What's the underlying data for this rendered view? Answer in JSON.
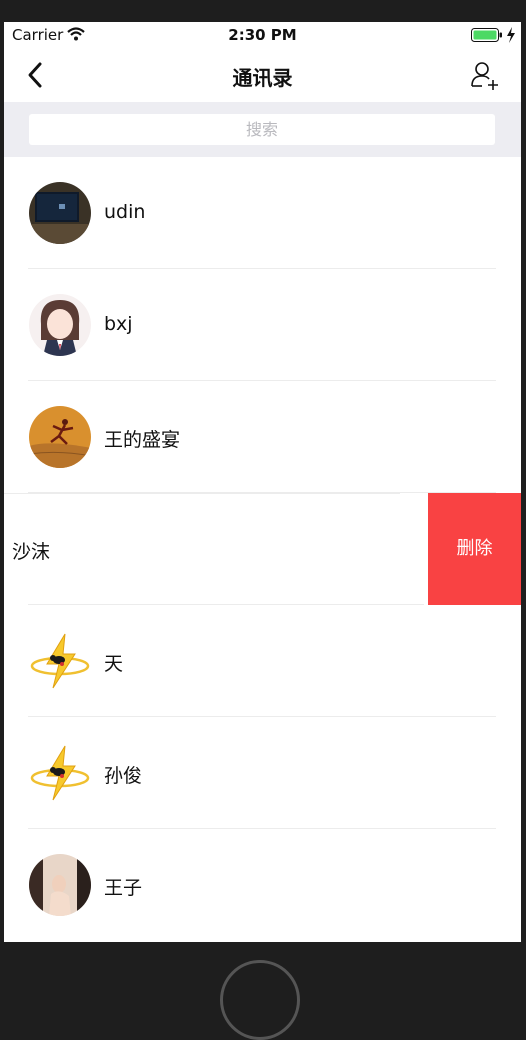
{
  "status_bar": {
    "carrier": "Carrier",
    "time": "2:30 PM"
  },
  "nav": {
    "title": "通讯录",
    "back_icon": "chevron-left-icon",
    "add_icon": "add-user-icon"
  },
  "search": {
    "placeholder": "搜索"
  },
  "contacts": [
    {
      "name": "udin"
    },
    {
      "name": "bxj"
    },
    {
      "name": "王的盛宴"
    },
    {
      "name": "沙沫",
      "delete_label": "删除"
    },
    {
      "name": "天"
    },
    {
      "name": "孙俊"
    },
    {
      "name": "王子"
    }
  ],
  "colors": {
    "delete": "#f94243",
    "search_bg": "#ededf2",
    "battery": "#4cd964"
  }
}
